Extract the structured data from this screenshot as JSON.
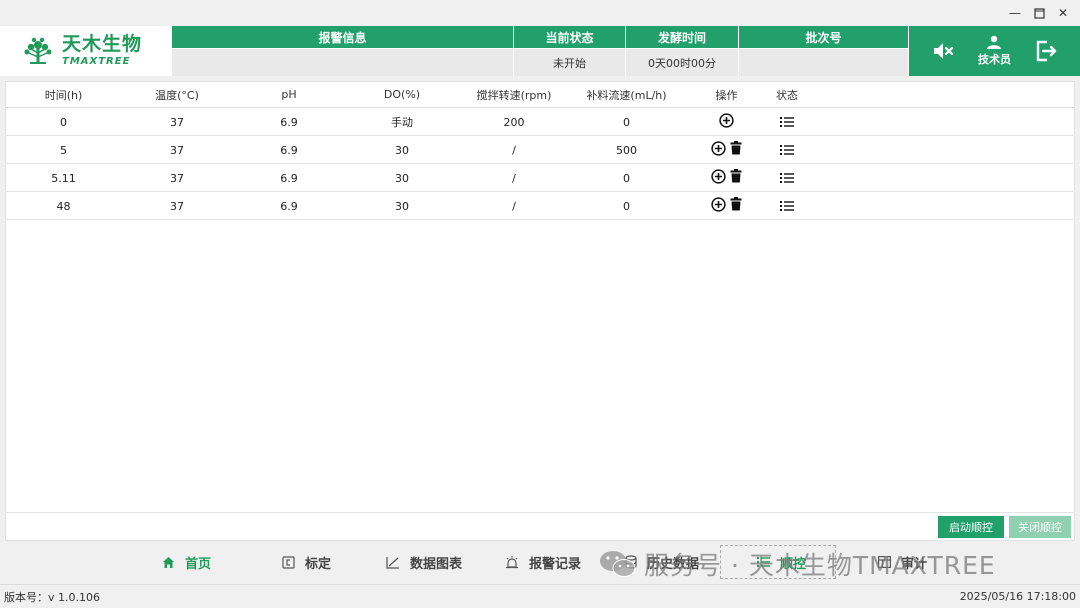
{
  "window": {
    "minimize": "—",
    "maximize": "☐",
    "close": "✕"
  },
  "logo": {
    "cn": "天木生物",
    "en": "TMAXTREE"
  },
  "info": {
    "columns": [
      {
        "head": "报警信息",
        "value": ""
      },
      {
        "head": "当前状态",
        "value": "未开始"
      },
      {
        "head": "发酵时间",
        "value": "0天00时00分"
      },
      {
        "head": "批次号",
        "value": ""
      }
    ]
  },
  "actions": {
    "mute_icon": "speaker-muted-icon",
    "user_label": "技术员",
    "logout_icon": "logout-icon"
  },
  "table": {
    "headers": [
      "时间(h)",
      "温度(°C)",
      "pH",
      "DO(%)",
      "搅拌转速(rpm)",
      "补料流速(mL/h)",
      "操作",
      "状态"
    ],
    "rows": [
      {
        "time": "0",
        "temp": "37",
        "ph": "6.9",
        "do": "手动",
        "rpm": "200",
        "flow": "0",
        "deletable": false
      },
      {
        "time": "5",
        "temp": "37",
        "ph": "6.9",
        "do": "30",
        "rpm": "/",
        "flow": "500",
        "deletable": true
      },
      {
        "time": "5.11",
        "temp": "37",
        "ph": "6.9",
        "do": "30",
        "rpm": "/",
        "flow": "0",
        "deletable": true
      },
      {
        "time": "48",
        "temp": "37",
        "ph": "6.9",
        "do": "30",
        "rpm": "/",
        "flow": "0",
        "deletable": true
      }
    ]
  },
  "buttons": {
    "start": "启动顺控",
    "stop": "关闭顺控"
  },
  "nav": {
    "home": "首页",
    "calibration": "标定",
    "charts": "数据图表",
    "alarms": "报警记录",
    "history": "历史数据",
    "sequence": "顺控",
    "audit": "审计"
  },
  "watermark": "服务号 · 天木生物TMAXTREE",
  "status": {
    "version": "版本号：v 1.0.106",
    "datetime": "2025/05/16 17:18:00"
  },
  "colors": {
    "brand": "#22a06b",
    "brand_light": "#8fd0b1"
  }
}
